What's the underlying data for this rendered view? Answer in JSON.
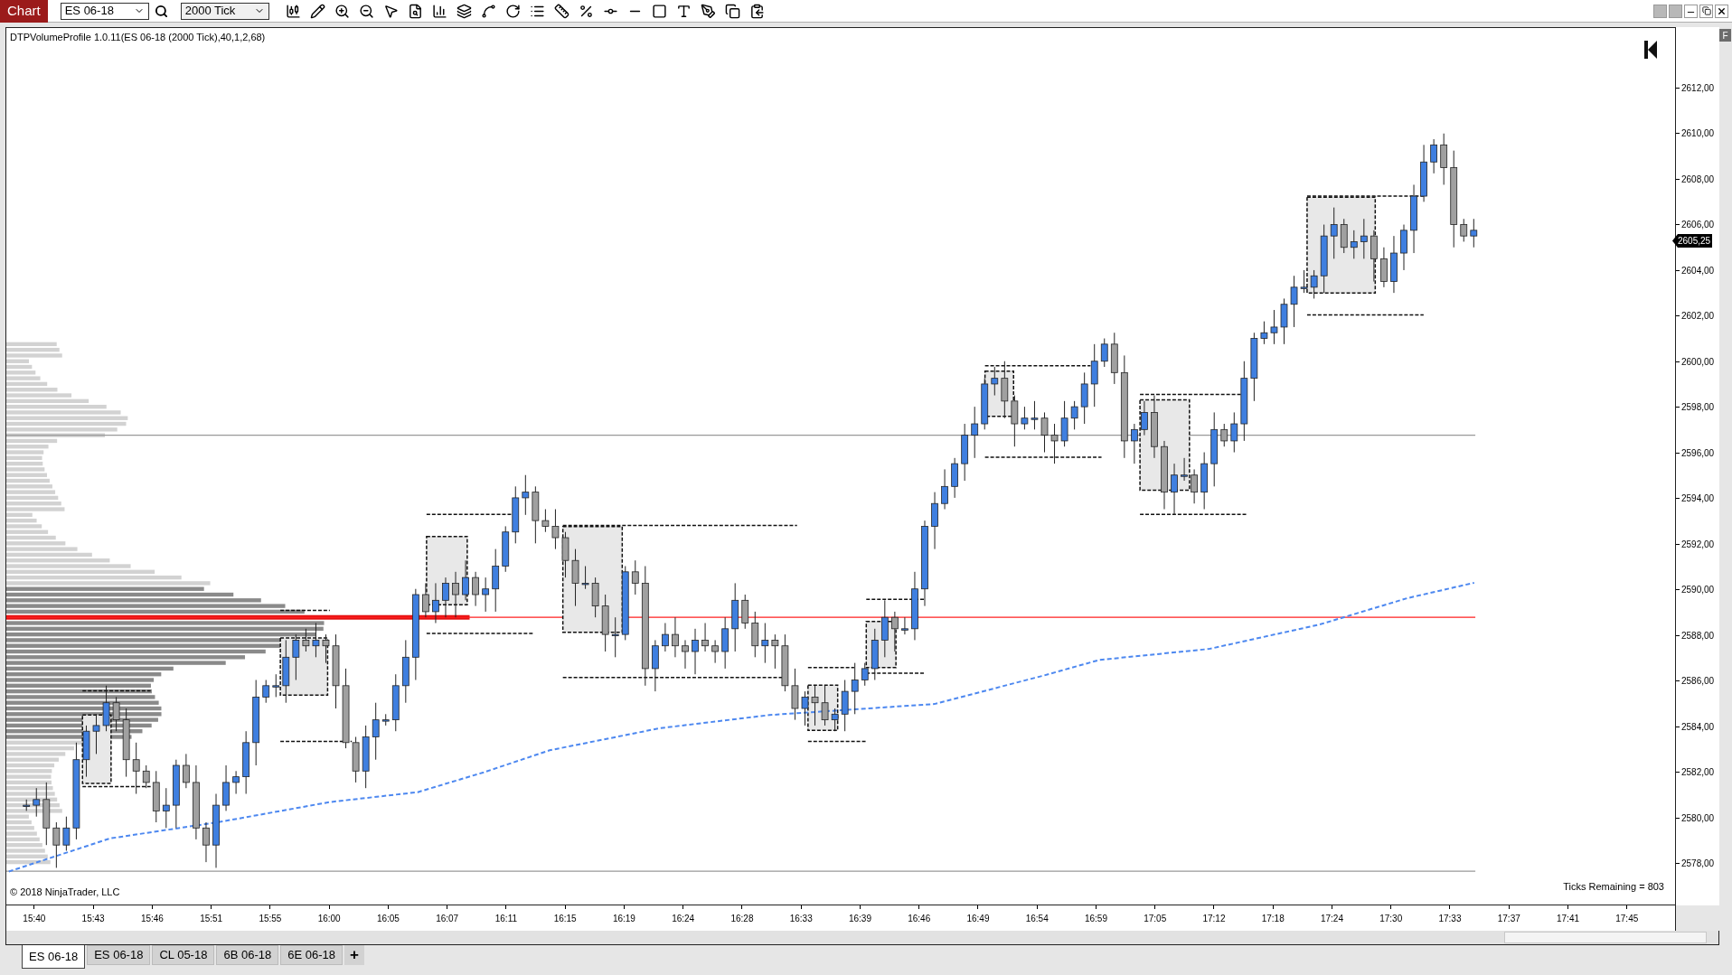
{
  "toolbar": {
    "title": "Chart",
    "instrument": "ES 06-18",
    "interval": "2000 Tick"
  },
  "indicator_label": "DTPVolumeProfile 1.0.11(ES 06-18 (2000 Tick),40,1,2,68)",
  "copyright": "© 2018 NinjaTrader, LLC",
  "ticks_remaining": "Ticks Remaining = 803",
  "side_button": "F",
  "price_axis": {
    "labels": [
      "2612,00",
      "2610,00",
      "2608,00",
      "2606,00",
      "2604,00",
      "2602,00",
      "2600,00",
      "2598,00",
      "2596,00",
      "2594,00",
      "2592,00",
      "2590,00",
      "2588,00",
      "2586,00",
      "2584,00",
      "2582,00",
      "2580,00",
      "2578,00"
    ],
    "last_price": "2605,25"
  },
  "time_axis": {
    "labels": [
      "15:40",
      "15:43",
      "15:46",
      "15:51",
      "15:55",
      "16:00",
      "16:05",
      "16:07",
      "16:11",
      "16:15",
      "16:19",
      "16:24",
      "16:28",
      "16:33",
      "16:39",
      "16:46",
      "16:49",
      "16:54",
      "16:59",
      "17:05",
      "17:12",
      "17:18",
      "17:24",
      "17:30",
      "17:33",
      "17:37",
      "17:41",
      "17:45"
    ]
  },
  "tabs": [
    {
      "label": "ES 06-18",
      "selected": true
    },
    {
      "label": "ES 06-18",
      "selected": false
    },
    {
      "label": "CL 05-18",
      "selected": false
    },
    {
      "label": "6B 06-18",
      "selected": false
    },
    {
      "label": "6E 06-18",
      "selected": false
    }
  ],
  "add_tab": "+"
}
